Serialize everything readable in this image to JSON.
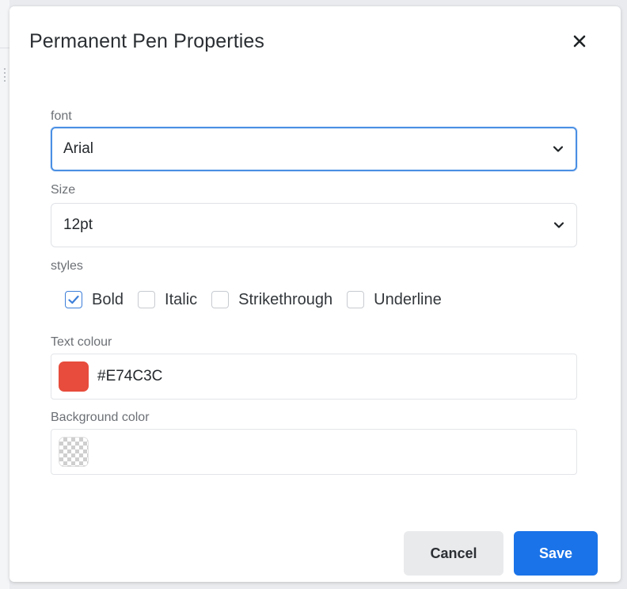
{
  "dialog": {
    "title": "Permanent Pen Properties",
    "close_icon": "close-icon"
  },
  "font": {
    "label": "font",
    "value": "Arial",
    "icon": "chevron-down-icon"
  },
  "size": {
    "label": "Size",
    "value": "12pt",
    "icon": "chevron-down-icon"
  },
  "styles": {
    "label": "styles",
    "options": [
      {
        "label": "Bold",
        "checked": true
      },
      {
        "label": "Italic",
        "checked": false
      },
      {
        "label": "Strikethrough",
        "checked": false
      },
      {
        "label": "Underline",
        "checked": false
      }
    ]
  },
  "text_colour": {
    "label": "Text colour",
    "value": "#E74C3C",
    "swatch_color": "#E74C3C"
  },
  "background_color": {
    "label": "Background color",
    "value": "",
    "swatch": "transparent-checker"
  },
  "buttons": {
    "cancel_label": "Cancel",
    "save_label": "Save"
  },
  "colors": {
    "accent": "#1a73e8",
    "focus_border": "#4a8fe3",
    "checkbox_check": "#3d7fd9"
  }
}
